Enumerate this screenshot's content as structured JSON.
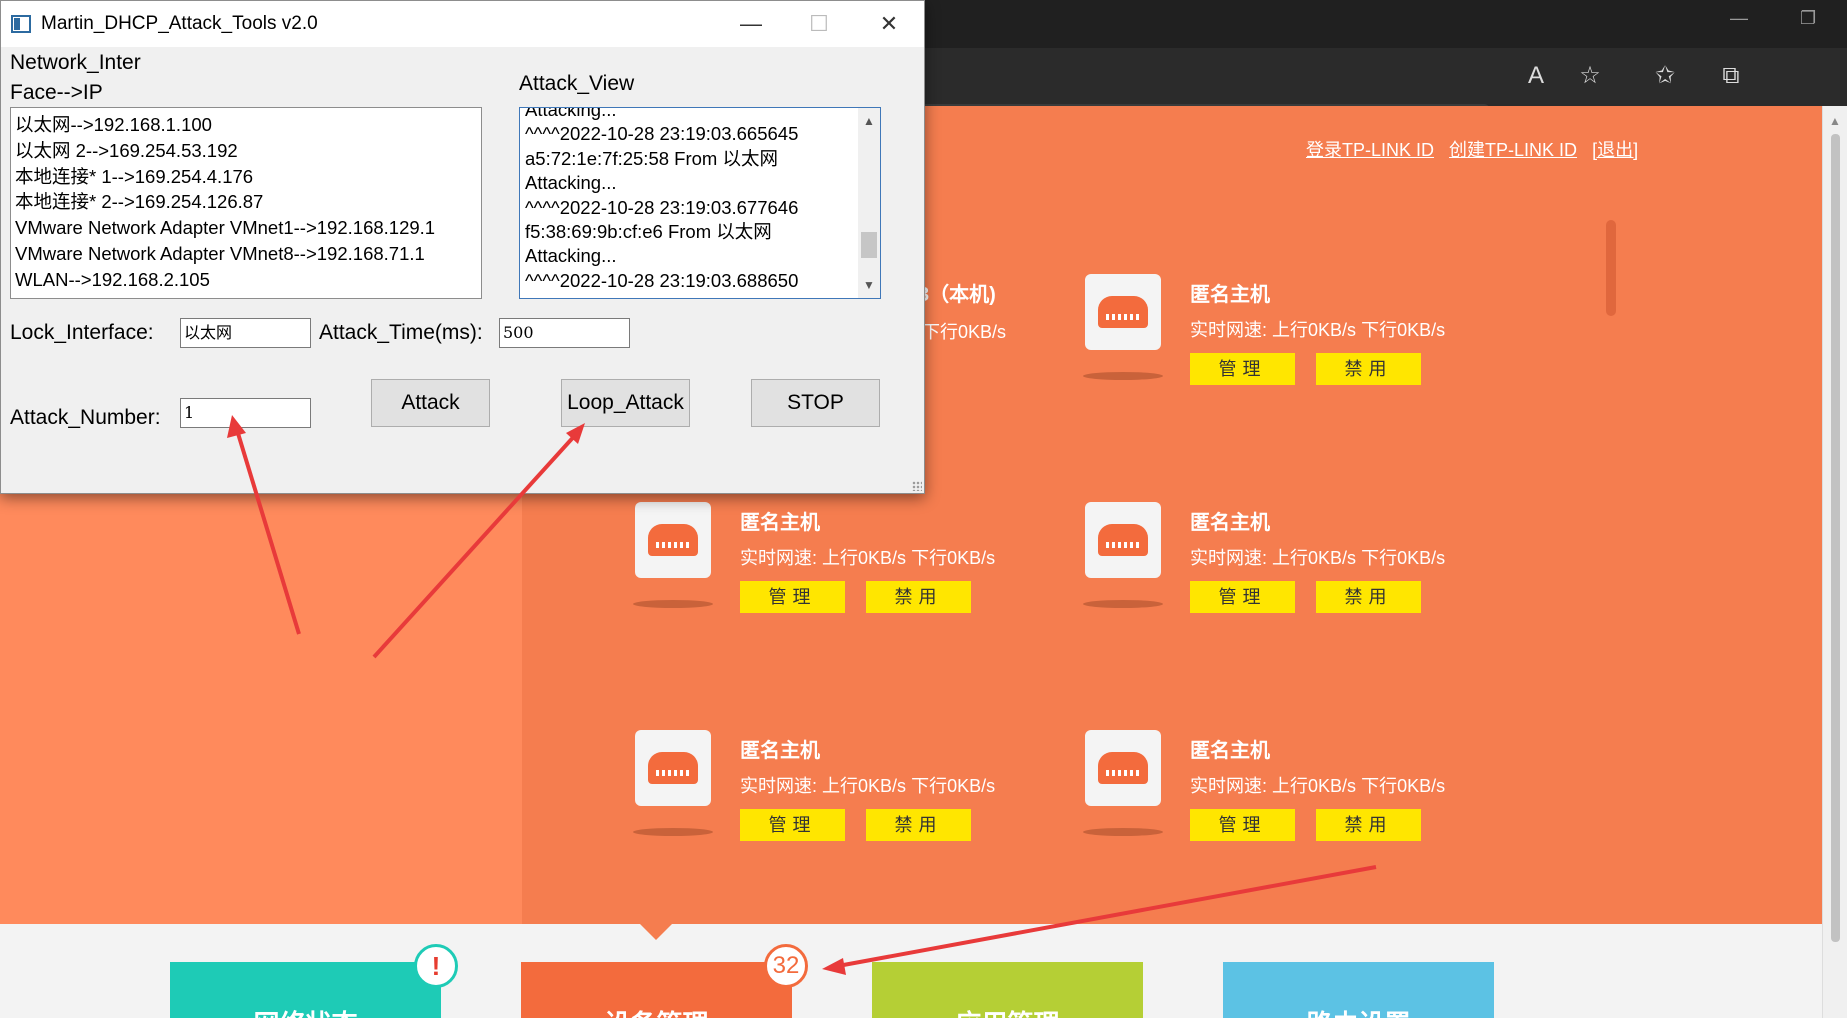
{
  "tool": {
    "title": "Martin_DHCP_Attack_Tools v2.0",
    "network_label_line1": "Network_Inter",
    "network_label_line2": "Face-->IP",
    "interfaces": [
      "以太网-->192.168.1.100",
      "以太网 2-->169.254.53.192",
      "本地连接* 1-->169.254.4.176",
      "本地连接* 2-->169.254.126.87",
      "VMware Network Adapter VMnet1-->192.168.129.1",
      "VMware Network Adapter VMnet8-->192.168.71.1",
      "WLAN-->192.168.2.105"
    ],
    "attack_view_label": "Attack_View",
    "attack_view_lines": [
      "Attacking...",
      "^^^^2022-10-28 23:19:03.665645",
      "a5:72:1e:7f:25:58 From 以太网",
      "Attacking...",
      "^^^^2022-10-28 23:19:03.677646",
      "f5:38:69:9b:cf:e6 From 以太网",
      "Attacking...",
      "^^^^2022-10-28 23:19:03.688650"
    ],
    "lock_interface_label": "Lock_Interface:",
    "lock_interface_value": "以太网",
    "attack_time_label": "Attack_Time(ms):",
    "attack_time_value": "500",
    "attack_number_label": "Attack_Number:",
    "attack_number_value": "1",
    "attack_button": "Attack",
    "loop_attack_button": "Loop_Attack",
    "stop_button": "STOP",
    "minimize_symbol": "—",
    "maximize_symbol": "☐",
    "close_symbol": "✕"
  },
  "router_page": {
    "links": [
      "登录TP-LINK ID",
      "创建TP-LINK ID",
      "[退出]"
    ],
    "partial_host_name": "3（本机)",
    "partial_host_speed": "下行0KB/s",
    "host_name": "匿名主机",
    "speed_label": "实时网速:",
    "upload": "上行0KB/s",
    "download": "下行0KB/s",
    "manage_button": "管理",
    "disable_button": "禁用",
    "tabs": [
      {
        "label": "网络状态",
        "color": "#1ecbb6"
      },
      {
        "label": "设备管理",
        "color": "#f36b3d"
      },
      {
        "label": "应用管理",
        "color": "#b5cf35"
      },
      {
        "label": "路由设置",
        "color": "#5cc2e4"
      }
    ],
    "alert_badge": "!",
    "device_count": "32"
  },
  "colors": {
    "orange": "#f57d4f",
    "yellow_button": "#ffe600",
    "arrow_red": "#e83a3a"
  },
  "icons": [
    "read-aloud-icon",
    "add-favorite-icon",
    "favorites-icon",
    "collections-icon",
    "profile-avatar-icon",
    "router-icon",
    "window-icon"
  ]
}
